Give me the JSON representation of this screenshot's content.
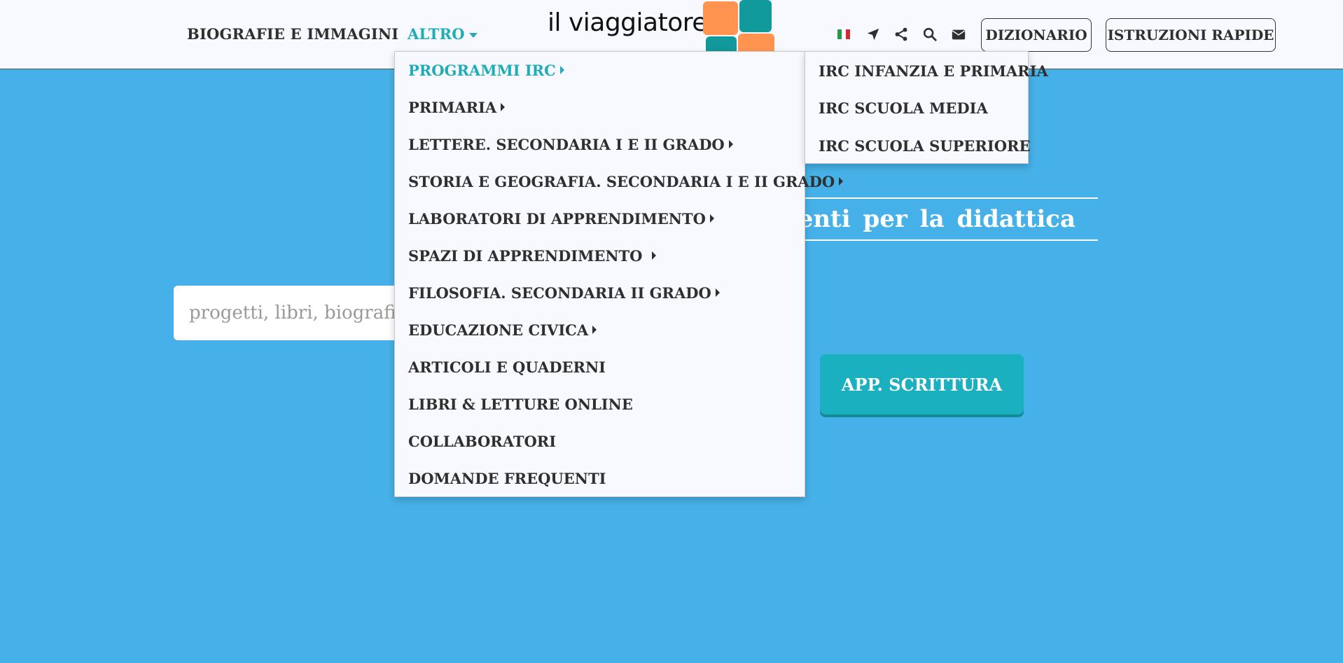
{
  "header": {
    "nav": {
      "biografie": "BIOGRAFIE E IMMAGINI",
      "altro": "ALTRO"
    },
    "logo_text": "il viaggiatore",
    "buttons": {
      "dizionario": "DIZIONARIO",
      "istruzioni": "ISTRUZIONI RAPIDE"
    },
    "icons": [
      "italian-flag-icon",
      "location-arrow-icon",
      "share-icon",
      "search-icon",
      "envelope-icon"
    ]
  },
  "colors": {
    "accent": "#1eadb8",
    "background": "#46b1e8",
    "logo_orange": "#ff9450",
    "logo_teal": "#12999b"
  },
  "dropdown": {
    "items": [
      {
        "label": "PROGRAMMI IRC",
        "has_submenu": true,
        "active": true
      },
      {
        "label": "PRIMARIA",
        "has_submenu": true
      },
      {
        "label": "LETTERE. SECONDARIA I E II GRADO",
        "has_submenu": true
      },
      {
        "label": "STORIA E GEOGRAFIA. SECONDARIA I E II GRADO",
        "has_submenu": true
      },
      {
        "label": "LABORATORI DI APPRENDIMENTO",
        "has_submenu": true
      },
      {
        "label": "SPAZI DI APPRENDIMENTO",
        "has_submenu": true
      },
      {
        "label": "FILOSOFIA. SECONDARIA II GRADO",
        "has_submenu": true
      },
      {
        "label": "EDUCAZIONE CIVICA",
        "has_submenu": true
      },
      {
        "label": "ARTICOLI E QUADERNI",
        "has_submenu": false
      },
      {
        "label": "LIBRI & LETTURE ONLINE",
        "has_submenu": false
      },
      {
        "label": "COLLABORATORI",
        "has_submenu": false
      },
      {
        "label": "DOMANDE FREQUENTI",
        "has_submenu": false
      }
    ]
  },
  "submenu": {
    "items": [
      "IRC INFANZIA E PRIMARIA",
      "IRC SCUOLA MEDIA",
      "IRC SCUOLA SUPERIORE"
    ]
  },
  "hero": {
    "title_visible": "umenti per la didattica"
  },
  "search": {
    "placeholder": "progetti, libri, biografie,"
  },
  "app_button": {
    "label": "APP. SCRITTURA"
  }
}
